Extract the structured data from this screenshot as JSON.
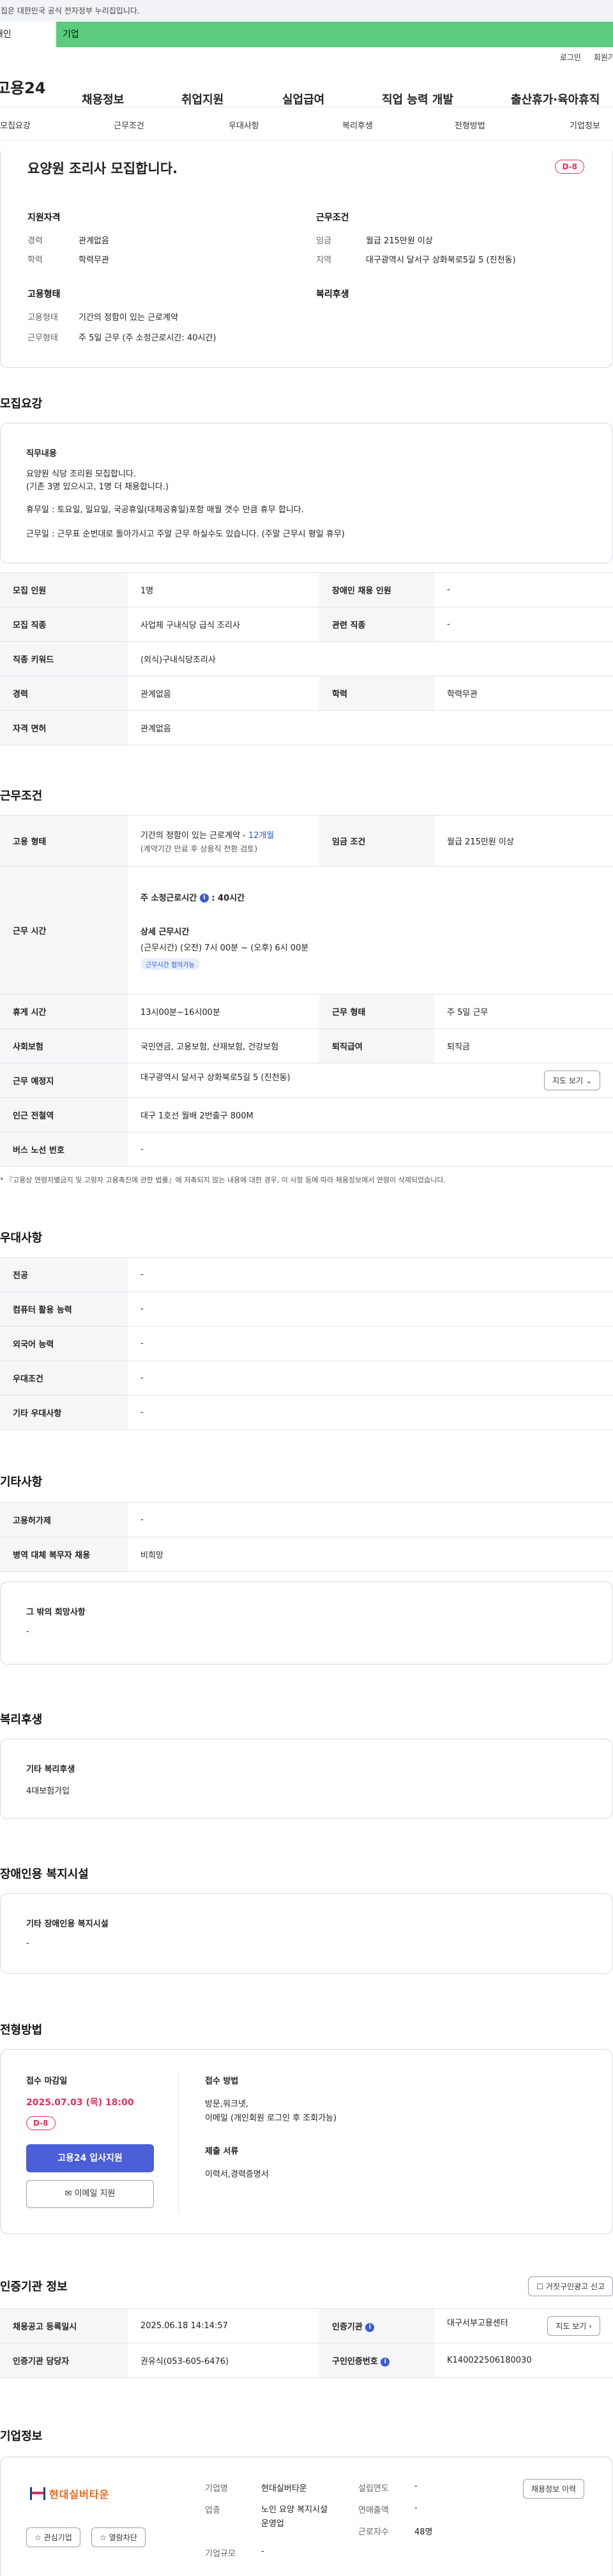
{
  "gov_notice": "이 누리집은 대한민국 공식 전자정부 누리집입니다.",
  "tabs": {
    "person": "개인",
    "company": "기업"
  },
  "util": {
    "login": "로그인",
    "join": "회원가입"
  },
  "gnb": {
    "logo": "고용24",
    "menus": [
      "채용정보",
      "취업지원",
      "실업급여",
      "직업 능력 개발",
      "출산휴가·육아휴직"
    ]
  },
  "subnav": [
    "모집요강",
    "근무조건",
    "우대사항",
    "복리후생",
    "전형방법",
    "기업정보"
  ],
  "summary": {
    "title": "요양원 조리사 모집합니다.",
    "dday": "D-8",
    "qual_title": "지원자격",
    "cond_title": "근무조건",
    "career_label": "경력",
    "career": "관계없음",
    "edu_label": "학력",
    "edu": "학력무관",
    "wage_label": "임금",
    "wage": "월급 215만원 이상",
    "region_label": "지역",
    "region": "대구광역시 달서구 상화북로5길 5 (진천동)",
    "emp_title": "고용형태",
    "welfare_title": "복리후생",
    "emptype_label": "고용형태",
    "emptype": "기간의 정함이 있는 근로계약",
    "worktype_label": "근무형태",
    "worktype": "주 5일 근무 (주 소정근로시간: 40시간)"
  },
  "recruit": {
    "heading": "모집요강",
    "duty_title": "직무내용",
    "duty_lines": [
      "요양원 식당 조리원 모집합니다.",
      "(기존 3명 있으시고, 1명 더 채용합니다.)",
      "",
      "휴무일 : 토요일, 일요일, 국공휴일(대체공휴일)포함 매월 갯수 만큼 휴무 합니다.",
      "",
      "근무일 : 근무표 순번대로 돌아가시고 주말 근무 하실수도 있습니다. (주말 근무시 평일 휴무)"
    ],
    "rows": [
      {
        "k1": "모집 인원",
        "v1": "1명",
        "k2": "장애인 채용 인원",
        "v2": "-"
      },
      {
        "k1": "모집 직종",
        "v1": "사업체 구내식당 급식 조리사",
        "k2": "관련 직종",
        "v2": "-"
      },
      {
        "k1": "직종 키워드",
        "v1": "(외식)구내식당조리사",
        "k2": "",
        "v2": ""
      },
      {
        "k1": "경력",
        "v1": "관계없음",
        "k2": "학력",
        "v2": "학력무관"
      },
      {
        "k1": "자격 면허",
        "v1": "관계없음",
        "k2": "",
        "v2": ""
      }
    ]
  },
  "conditions": {
    "heading": "근무조건",
    "emp_label": "고용 형태",
    "emp_value": "기간의 정함이 있는 근로계약 - ",
    "emp_months": "12개월",
    "emp_sub": "(계약기간 만료 후 상용직 전환 검토)",
    "wage_label": "임금 조건",
    "wage_value": "월급 215만원 이상",
    "hours_label": "근무 시간",
    "hours_week": "주 소정근로시간",
    "hours_week_value": ": 40시간",
    "hours_detail_title": "상세 근무시간",
    "hours_detail": "(근무시간) (오전) 7시 00분 ~ (오후) 6시 00분",
    "hours_badge": "근무시간 협의가능",
    "break_label": "휴게 시간",
    "break_value": "13시00분~16시00분",
    "form_label": "근무 형태",
    "form_value": "주 5일 근무",
    "insurance_label": "사회보험",
    "insurance_value": "국민연금, 고용보험, 산재보험, 건강보험",
    "retire_label": "퇴직급여",
    "retire_value": "퇴직금",
    "place_label": "근무 예정지",
    "place_value": "대구광역시 달서구 상화북로5길 5 (진천동)",
    "map_btn": "지도 보기",
    "station_label": "인근 전철역",
    "station_value": "대구 1호선 월배 2번출구 800M",
    "bus_label": "버스 노선 번호",
    "bus_value": "-",
    "note": "* 『고용상 연령차별금지 및 고령자 고용촉진에 관한 법률』에 저촉되지 않는 내용에 대한 경우, 이 사항 등에 따라 채용정보에서 연령이 삭제되었습니다."
  },
  "preference": {
    "heading": "우대사항",
    "rows": [
      {
        "k": "전공",
        "v": "-"
      },
      {
        "k": "컴퓨터 활용 능력",
        "v": "-"
      },
      {
        "k": "외국어 능력",
        "v": "-"
      },
      {
        "k": "우대조건",
        "v": "-"
      },
      {
        "k": "기타 우대사항",
        "v": "-"
      }
    ]
  },
  "etc": {
    "heading": "기타사항",
    "rows": [
      {
        "k": "고용허가제",
        "v": "-"
      },
      {
        "k": "병역 대체 복무자 채용",
        "v": "비희망"
      }
    ],
    "hope_title": "그 밖의 희망사항",
    "hope_value": "-"
  },
  "welfare": {
    "heading": "복리후생",
    "title": "기타 복리후생",
    "value": "4대보험가입"
  },
  "disabled": {
    "heading": "장애인용 복지시설",
    "title": "기타 장애인용 복지시설",
    "value": "-"
  },
  "selection": {
    "heading": "전형방법",
    "deadline_title": "접수 마감일",
    "deadline": "2025.07.03 (목) 18:00",
    "dday": "D-8",
    "apply_btn": "고용24 입사지원",
    "email_btn": "이메일 지원",
    "method_title": "접수 방법",
    "method_lines": [
      "방문,워크넷,",
      "이메일 (개인회원 로그인 후 조회가능)"
    ],
    "docs_title": "제출 서류",
    "docs": "이력서,경력증명서"
  },
  "cert": {
    "heading": "인증기관 정보",
    "report_btn": "거짓구인광고 신고",
    "reg_label": "채용공고 등록일시",
    "reg_value": "2025.06.18 14:14:57",
    "agency_label": "인증기관",
    "agency_value": "대구서부고용센터",
    "map_btn": "지도 보기",
    "manager_label": "인증기관 담당자",
    "manager_value": "권유식(053-605-6476)",
    "job_no_label": "구인인증번호",
    "job_no_value": "K140022506180030"
  },
  "company": {
    "heading": "기업정보",
    "logo_text": "현대실버타운",
    "fav_btn": "관심기업",
    "block_btn": "열람차단",
    "name_label": "기업명",
    "name": "현대실버타운",
    "industry_label": "업종",
    "industry": "노인 요양 복지시설 운영업",
    "size_label": "기업규모",
    "size": "-",
    "founded_label": "설립연도",
    "founded": "-",
    "sales_label": "연매출액",
    "sales": "-",
    "staff_label": "근로자수",
    "staff": "48명",
    "history_btn": "채용정보 이력"
  }
}
